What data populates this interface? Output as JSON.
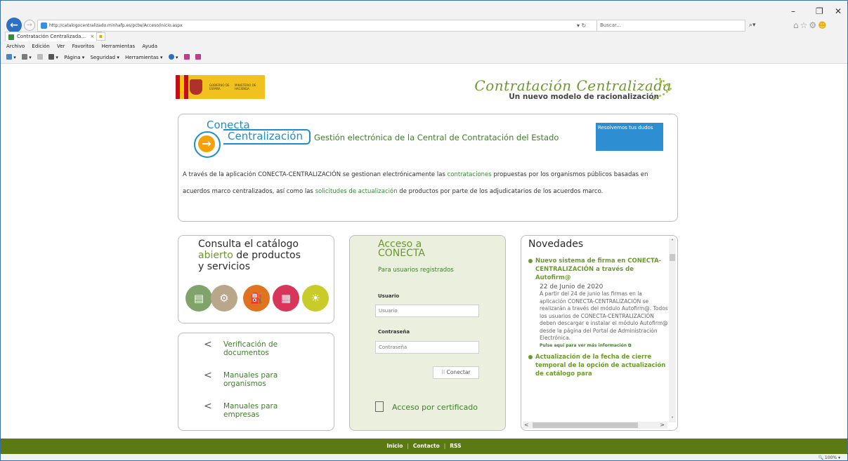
{
  "browser": {
    "url": "http://catalogocentralizado.minhafp.es/pctw/Acceso/inicio.aspx",
    "refresh": "▾ ↻",
    "search_placeholder": "Buscar...",
    "tab_title": "Contratación Centralizada... ",
    "menu": [
      "Archivo",
      "Edición",
      "Ver",
      "Favoritos",
      "Herramientas",
      "Ayuda"
    ],
    "cmd": {
      "page": "Página ▾",
      "security": "Seguridad ▾",
      "tools": "Herramientas ▾"
    },
    "zoom": "🔍 100%  ▾"
  },
  "brand": {
    "gov_line1": "GOBIERNO DE ESPAÑA",
    "gov_line2": "MINISTERIO DE HACIENDA",
    "title": "Contratación Centralizada",
    "subtitle": "Un nuevo modelo de racionalización"
  },
  "banner": {
    "logo_word1": "Conecta",
    "logo_word2": "Centralización",
    "headline": "Gestión electrónica de la Central de Contratación del Estado",
    "resolve": "Resolvemos tus dudos",
    "text_a": "A través de la aplicación CONECTA-CENTRALIZACIÓN se gestionan electrónicamente las ",
    "link_a": "contrataciones",
    "text_b": " propuestas por los organismos públicos basadas en acuerdos marco centralizados, así como las ",
    "link_b": "solicitudes de actualización",
    "text_c": " de productos por parte de los adjudicatarios de los acuerdos marco."
  },
  "catalog": {
    "line1": "Consulta el catálogo",
    "line2a": "abierto",
    "line2b": " de productos",
    "line3": "y servicios"
  },
  "links": [
    {
      "line1": "Verificación de",
      "line2": "documentos"
    },
    {
      "line1": "Manuales para",
      "line2": "organismos"
    },
    {
      "line1": "Manuales para",
      "line2": "empresas"
    }
  ],
  "access": {
    "title1": "Acceso a",
    "title2": "CONECTA",
    "subtitle": "Para usuarios registrados",
    "user_label": "Usuario",
    "user_placeholder": "Usuario",
    "pass_label": "Contraseña",
    "pass_placeholder": "Contraseña",
    "connect": "Conectar",
    "cert": "Acceso por certificado"
  },
  "news": {
    "title": "Novedades",
    "item1_title": "Nuevo sistema de firma en CONECTA-CENTRALIZACIÓN a través de Autofirm@",
    "item1_date": "22 de Junio de 2020",
    "item1_body": "A partir del 24 de junio las firmas en la aplicación CONECTA-CENTRALIZACIÓN se realizarán a través del módulo Autofirm@. Todos los usuarios de CONECTA-CENTRALIZACIÓN deben descargar e instalar el módulo Autofirm@ desde la página del Portal de Administración Electrónica.",
    "item1_more": "Pulse aquí para ver más información",
    "item2_title": "Actualización de la fecha de cierre temporal de la opción de actualización de catálogo para"
  },
  "footer": {
    "home": "Inicio",
    "contact": "Contacto",
    "rss": "RSS"
  }
}
